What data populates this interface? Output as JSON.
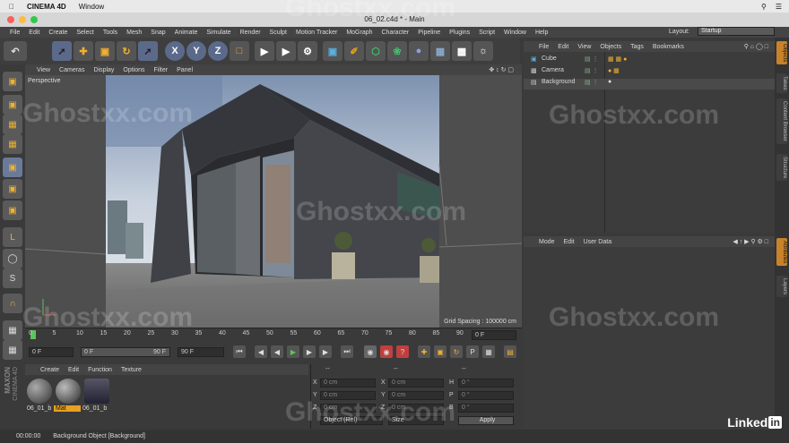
{
  "mac_menu": {
    "app": "CINEMA 4D",
    "window": "Window"
  },
  "window_title": "06_02.c4d * - Main",
  "menu": [
    "File",
    "Edit",
    "Create",
    "Select",
    "Tools",
    "Mesh",
    "Snap",
    "Animate",
    "Simulate",
    "Render",
    "Sculpt",
    "Motion Tracker",
    "MoGraph",
    "Character",
    "Pipeline",
    "Plugins",
    "Script",
    "Window",
    "Help"
  ],
  "layout": {
    "label": "Layout:",
    "value": "Startup"
  },
  "viewport": {
    "menu": [
      "View",
      "Cameras",
      "Display",
      "Options",
      "Filter",
      "Panel"
    ],
    "label": "Perspective",
    "grid_spacing": "Grid Spacing : 100000 cm"
  },
  "timeline": {
    "ticks": [
      "0",
      "5",
      "10",
      "15",
      "20",
      "25",
      "30",
      "35",
      "40",
      "45",
      "50",
      "55",
      "60",
      "65",
      "70",
      "75",
      "80",
      "85",
      "90"
    ],
    "current_frame": "0 F"
  },
  "transport": {
    "start": "0 F",
    "range_start": "0 F",
    "range_end": "90 F",
    "end": "90 F"
  },
  "object_manager": {
    "menu": [
      "File",
      "Edit",
      "View",
      "Objects",
      "Tags",
      "Bookmarks"
    ],
    "objects": [
      {
        "name": "Cube"
      },
      {
        "name": "Camera"
      },
      {
        "name": "Background"
      }
    ]
  },
  "attribute_manager": {
    "menu": [
      "Mode",
      "Edit",
      "User Data"
    ]
  },
  "material_manager": {
    "menu": [
      "Create",
      "Edit",
      "Function",
      "Texture"
    ],
    "materials": [
      {
        "name": "06_01_b"
      },
      {
        "name": "Mat"
      },
      {
        "name": "06_01_b"
      }
    ]
  },
  "coordinates": {
    "header": [
      "--",
      "--",
      "--"
    ],
    "rows": [
      {
        "a": "X",
        "av": "0 cm",
        "b": "X",
        "bv": "0 cm",
        "c": "H",
        "cv": "0 °"
      },
      {
        "a": "Y",
        "av": "0 cm",
        "b": "Y",
        "bv": "0 cm",
        "c": "P",
        "cv": "0 °"
      },
      {
        "a": "Z",
        "av": "0 cm",
        "b": "Z",
        "bv": "0 cm",
        "c": "B",
        "cv": "0 °"
      }
    ],
    "mode": "Object (Rel)",
    "size": "Size",
    "apply": "Apply"
  },
  "side_tabs": [
    "Objects",
    "Takes",
    "Content Browser",
    "Structure",
    "Attributes",
    "Layers"
  ],
  "maxon": {
    "brand": "MAXON",
    "product": "CINEMA 4D"
  },
  "status": {
    "time": "00:00:00",
    "message": "Background Object [Background]"
  },
  "watermarks": [
    "Ghostxx.com",
    "Ghostxx.com",
    "Ghostxx.com",
    "Ghostxx.com",
    "Ghostxx.com",
    "Ghostxx.com",
    "Ghostxx.com",
    "Ghostxx.com",
    "Ghostxx.com"
  ],
  "linkedin": "Linked"
}
